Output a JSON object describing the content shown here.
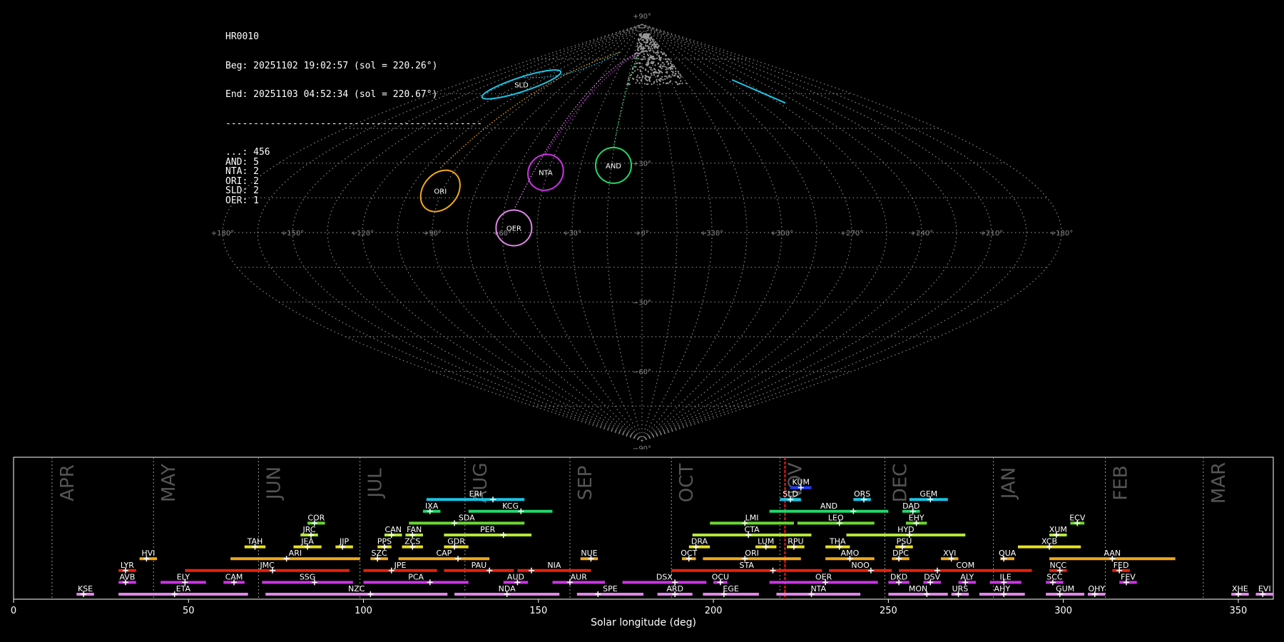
{
  "info": {
    "title": "HR0010",
    "beg": "Beg: 20251102 19:02:57 (sol = 220.26°)",
    "end": "End: 20251103 04:52:34 (sol = 220.67°)",
    "rule": "----------------------------------------------",
    "counts": [
      {
        "code": "...",
        "count": "456"
      },
      {
        "code": "AND",
        "count": "5"
      },
      {
        "code": "NTA",
        "count": "2"
      },
      {
        "code": "ORI",
        "count": "2"
      },
      {
        "code": "SLD",
        "count": "2"
      },
      {
        "code": "OER",
        "count": "1"
      }
    ]
  },
  "sky_map": {
    "lat_labels": [
      "+90°",
      "+30°",
      "−30°",
      "−60°",
      "−90°"
    ],
    "lon_labels": [
      "+180°",
      "+150°",
      "+120°",
      "+90°",
      "+60°",
      "+30°",
      "+0°",
      "+330°",
      "+300°",
      "+270°",
      "+240°",
      "+210°",
      "+180°"
    ],
    "radiants": [
      {
        "code": "SLD",
        "color": "#19c6e6",
        "lon": 118,
        "lat": 64
      },
      {
        "code": "ORI",
        "color": "#f0a818",
        "lon": 91,
        "lat": 18
      },
      {
        "code": "NTA",
        "color": "#cc33e6",
        "lon": 46,
        "lat": 26
      },
      {
        "code": "AND",
        "color": "#22d86a",
        "lon": 14,
        "lat": 29
      },
      {
        "code": "OER",
        "color": "#e085e8",
        "lon": 55,
        "lat": 2
      }
    ]
  },
  "chart_data": {
    "type": "timeline",
    "xlabel": "Solar longitude (deg)",
    "xlim": [
      0,
      360
    ],
    "xticks": [
      0,
      50,
      100,
      150,
      200,
      250,
      300,
      350
    ],
    "current_sol": 220.46,
    "months": [
      {
        "label": "APR",
        "start": 11
      },
      {
        "label": "MAY",
        "start": 40
      },
      {
        "label": "JUN",
        "start": 70
      },
      {
        "label": "JUL",
        "start": 99
      },
      {
        "label": "AUG",
        "start": 129
      },
      {
        "label": "SEP",
        "start": 159
      },
      {
        "label": "OCT",
        "start": 188
      },
      {
        "label": "NOV",
        "start": 219
      },
      {
        "label": "DEC",
        "start": 249
      },
      {
        "label": "JAN",
        "start": 280
      },
      {
        "label": "FEB",
        "start": 312
      },
      {
        "label": "MAR",
        "start": 340
      }
    ],
    "showers": [
      {
        "code": "KUM",
        "start": 222,
        "end": 228,
        "peak": 225,
        "row": 9,
        "color": "#1f3cff"
      },
      {
        "code": "ERI",
        "start": 118,
        "end": 146,
        "peak": 137,
        "row": 8,
        "color": "#19c6e6"
      },
      {
        "code": "SLD",
        "start": 219,
        "end": 225,
        "peak": 222,
        "row": 8,
        "color": "#19c6e6"
      },
      {
        "code": "ORS",
        "start": 240,
        "end": 245,
        "peak": 243,
        "row": 8,
        "color": "#19c6e6"
      },
      {
        "code": "GEM",
        "start": 256,
        "end": 267,
        "peak": 262,
        "row": 8,
        "color": "#19c6e6"
      },
      {
        "code": "IXA",
        "start": 117,
        "end": 122,
        "peak": 119,
        "row": 7,
        "color": "#22d86a"
      },
      {
        "code": "KCG",
        "start": 130,
        "end": 154,
        "peak": 145,
        "row": 7,
        "color": "#22d86a"
      },
      {
        "code": "AND",
        "start": 216,
        "end": 250,
        "peak": 240,
        "row": 7,
        "color": "#22d86a"
      },
      {
        "code": "DAD",
        "start": 254,
        "end": 259,
        "peak": 257,
        "row": 7,
        "color": "#22d86a"
      },
      {
        "code": "COR",
        "start": 84,
        "end": 89,
        "peak": 86,
        "row": 6,
        "color": "#6ad830"
      },
      {
        "code": "SDA",
        "start": 113,
        "end": 146,
        "peak": 126,
        "row": 6,
        "color": "#6ad830"
      },
      {
        "code": "LMI",
        "start": 199,
        "end": 223,
        "peak": 209,
        "row": 6,
        "color": "#6ad830"
      },
      {
        "code": "LEO",
        "start": 224,
        "end": 246,
        "peak": 236,
        "row": 6,
        "color": "#6ad830"
      },
      {
        "code": "EHY",
        "start": 255,
        "end": 261,
        "peak": 258,
        "row": 6,
        "color": "#6ad830"
      },
      {
        "code": "ECV",
        "start": 302,
        "end": 306,
        "peak": 304,
        "row": 6,
        "color": "#6ad830"
      },
      {
        "code": "JRC",
        "start": 82,
        "end": 87,
        "peak": 85,
        "row": 5,
        "color": "#b6e63a"
      },
      {
        "code": "CAN",
        "start": 106,
        "end": 111,
        "peak": 108,
        "row": 5,
        "color": "#b6e63a"
      },
      {
        "code": "FAN",
        "start": 112,
        "end": 117,
        "peak": 114,
        "row": 5,
        "color": "#b6e63a"
      },
      {
        "code": "PER",
        "start": 123,
        "end": 148,
        "peak": 140,
        "row": 5,
        "color": "#b6e63a"
      },
      {
        "code": "CTA",
        "start": 194,
        "end": 228,
        "peak": 210,
        "row": 5,
        "color": "#b6e63a"
      },
      {
        "code": "HYD",
        "start": 238,
        "end": 272,
        "peak": 256,
        "row": 5,
        "color": "#b6e63a"
      },
      {
        "code": "XUM",
        "start": 296,
        "end": 301,
        "peak": 298,
        "row": 5,
        "color": "#b6e63a"
      },
      {
        "code": "TAH",
        "start": 66,
        "end": 72,
        "peak": 69,
        "row": 4,
        "color": "#e8e020"
      },
      {
        "code": "JEA",
        "start": 80,
        "end": 88,
        "peak": 84,
        "row": 4,
        "color": "#e8e020"
      },
      {
        "code": "JIP",
        "start": 92,
        "end": 97,
        "peak": 94,
        "row": 4,
        "color": "#e8e020"
      },
      {
        "code": "PPS",
        "start": 104,
        "end": 108,
        "peak": 106,
        "row": 4,
        "color": "#e8e020"
      },
      {
        "code": "ZCS",
        "start": 111,
        "end": 117,
        "peak": 114,
        "row": 4,
        "color": "#e8e020"
      },
      {
        "code": "GDR",
        "start": 123,
        "end": 130,
        "peak": 126,
        "row": 4,
        "color": "#e8e020"
      },
      {
        "code": "DRA",
        "start": 193,
        "end": 199,
        "peak": 195,
        "row": 4,
        "color": "#e8e020"
      },
      {
        "code": "LUM",
        "start": 212,
        "end": 218,
        "peak": 215,
        "row": 4,
        "color": "#e8e020"
      },
      {
        "code": "RPU",
        "start": 221,
        "end": 226,
        "peak": 223,
        "row": 4,
        "color": "#e8e020"
      },
      {
        "code": "THA",
        "start": 232,
        "end": 239,
        "peak": 236,
        "row": 4,
        "color": "#e8e020"
      },
      {
        "code": "PSU",
        "start": 252,
        "end": 257,
        "peak": 254,
        "row": 4,
        "color": "#e8e020"
      },
      {
        "code": "XCB",
        "start": 287,
        "end": 305,
        "peak": 296,
        "row": 4,
        "color": "#e8e020"
      },
      {
        "code": "HVI",
        "start": 36,
        "end": 41,
        "peak": 38,
        "row": 3,
        "color": "#f0a818"
      },
      {
        "code": "ARI",
        "start": 62,
        "end": 99,
        "peak": 78,
        "row": 3,
        "color": "#f0a818"
      },
      {
        "code": "SZC",
        "start": 102,
        "end": 107,
        "peak": 104,
        "row": 3,
        "color": "#f0a818"
      },
      {
        "code": "CAP",
        "start": 110,
        "end": 136,
        "peak": 127,
        "row": 3,
        "color": "#f0a818"
      },
      {
        "code": "NUE",
        "start": 162,
        "end": 167,
        "peak": 165,
        "row": 3,
        "color": "#f0a818"
      },
      {
        "code": "OCT",
        "start": 191,
        "end": 195,
        "peak": 193,
        "row": 3,
        "color": "#f0a818"
      },
      {
        "code": "ORI",
        "start": 197,
        "end": 225,
        "peak": 209,
        "row": 3,
        "color": "#f0a818"
      },
      {
        "code": "AMO",
        "start": 232,
        "end": 246,
        "peak": 239,
        "row": 3,
        "color": "#f0a818"
      },
      {
        "code": "DPC",
        "start": 251,
        "end": 256,
        "peak": 253,
        "row": 3,
        "color": "#f0a818"
      },
      {
        "code": "XVI",
        "start": 265,
        "end": 270,
        "peak": 268,
        "row": 3,
        "color": "#f0a818"
      },
      {
        "code": "QUA",
        "start": 282,
        "end": 286,
        "peak": 283,
        "row": 3,
        "color": "#f0a818"
      },
      {
        "code": "AAN",
        "start": 296,
        "end": 332,
        "peak": 314,
        "row": 3,
        "color": "#f0a818"
      },
      {
        "code": "LYR",
        "start": 30,
        "end": 35,
        "peak": 32,
        "row": 2,
        "color": "#e8200c"
      },
      {
        "code": "JMC",
        "start": 49,
        "end": 96,
        "peak": 74,
        "row": 2,
        "color": "#e8200c"
      },
      {
        "code": "JPE",
        "start": 100,
        "end": 121,
        "peak": 108,
        "row": 2,
        "color": "#e8200c"
      },
      {
        "code": "PAU",
        "start": 123,
        "end": 143,
        "peak": 136,
        "row": 2,
        "color": "#e8200c"
      },
      {
        "code": "NIA",
        "start": 144,
        "end": 165,
        "peak": 148,
        "row": 2,
        "color": "#e8200c"
      },
      {
        "code": "STA",
        "start": 188,
        "end": 231,
        "peak": 217,
        "row": 2,
        "color": "#e8200c"
      },
      {
        "code": "NOO",
        "start": 233,
        "end": 251,
        "peak": 245,
        "row": 2,
        "color": "#e8200c"
      },
      {
        "code": "COM",
        "start": 253,
        "end": 291,
        "peak": 264,
        "row": 2,
        "color": "#e8200c"
      },
      {
        "code": "NCC",
        "start": 296,
        "end": 301,
        "peak": 299,
        "row": 2,
        "color": "#e8200c"
      },
      {
        "code": "FED",
        "start": 314,
        "end": 319,
        "peak": 316,
        "row": 2,
        "color": "#e8200c"
      },
      {
        "code": "AVB",
        "start": 30,
        "end": 35,
        "peak": 32,
        "row": 1,
        "color": "#cc33e6"
      },
      {
        "code": "ELY",
        "start": 42,
        "end": 55,
        "peak": 49,
        "row": 1,
        "color": "#cc33e6"
      },
      {
        "code": "CAM",
        "start": 60,
        "end": 66,
        "peak": 63,
        "row": 1,
        "color": "#cc33e6"
      },
      {
        "code": "SSG",
        "start": 71,
        "end": 97,
        "peak": 86,
        "row": 1,
        "color": "#cc33e6"
      },
      {
        "code": "PCA",
        "start": 100,
        "end": 130,
        "peak": 119,
        "row": 1,
        "color": "#cc33e6"
      },
      {
        "code": "AUD",
        "start": 140,
        "end": 147,
        "peak": 144,
        "row": 1,
        "color": "#cc33e6"
      },
      {
        "code": "AUR",
        "start": 154,
        "end": 169,
        "peak": 159,
        "row": 1,
        "color": "#cc33e6"
      },
      {
        "code": "DSX",
        "start": 174,
        "end": 198,
        "peak": 189,
        "row": 1,
        "color": "#cc33e6"
      },
      {
        "code": "OCU",
        "start": 200,
        "end": 204,
        "peak": 202,
        "row": 1,
        "color": "#cc33e6"
      },
      {
        "code": "OER",
        "start": 216,
        "end": 247,
        "peak": 232,
        "row": 1,
        "color": "#cc33e6"
      },
      {
        "code": "DKD",
        "start": 250,
        "end": 256,
        "peak": 253,
        "row": 1,
        "color": "#cc33e6"
      },
      {
        "code": "DSV",
        "start": 260,
        "end": 265,
        "peak": 262,
        "row": 1,
        "color": "#cc33e6"
      },
      {
        "code": "ALY",
        "start": 270,
        "end": 275,
        "peak": 272,
        "row": 1,
        "color": "#cc33e6"
      },
      {
        "code": "ILE",
        "start": 279,
        "end": 288,
        "peak": 283,
        "row": 1,
        "color": "#cc33e6"
      },
      {
        "code": "SCC",
        "start": 295,
        "end": 300,
        "peak": 297,
        "row": 1,
        "color": "#cc33e6"
      },
      {
        "code": "FEV",
        "start": 316,
        "end": 321,
        "peak": 318,
        "row": 1,
        "color": "#cc33e6"
      },
      {
        "code": "KSE",
        "start": 18,
        "end": 23,
        "peak": 20,
        "row": 0,
        "color": "#e085e8"
      },
      {
        "code": "ETA",
        "start": 30,
        "end": 67,
        "peak": 46,
        "row": 0,
        "color": "#e085e8"
      },
      {
        "code": "NZC",
        "start": 72,
        "end": 124,
        "peak": 102,
        "row": 0,
        "color": "#e085e8"
      },
      {
        "code": "NDA",
        "start": 126,
        "end": 156,
        "peak": 141,
        "row": 0,
        "color": "#e085e8"
      },
      {
        "code": "SPE",
        "start": 161,
        "end": 180,
        "peak": 167,
        "row": 0,
        "color": "#e085e8"
      },
      {
        "code": "ARD",
        "start": 184,
        "end": 194,
        "peak": 189,
        "row": 0,
        "color": "#e085e8"
      },
      {
        "code": "EGE",
        "start": 197,
        "end": 213,
        "peak": 203,
        "row": 0,
        "color": "#e085e8"
      },
      {
        "code": "NTA",
        "start": 218,
        "end": 242,
        "peak": 228,
        "row": 0,
        "color": "#e085e8"
      },
      {
        "code": "MON",
        "start": 250,
        "end": 267,
        "peak": 261,
        "row": 0,
        "color": "#e085e8"
      },
      {
        "code": "URS",
        "start": 268,
        "end": 273,
        "peak": 270,
        "row": 0,
        "color": "#e085e8"
      },
      {
        "code": "AHY",
        "start": 276,
        "end": 289,
        "peak": 283,
        "row": 0,
        "color": "#e085e8"
      },
      {
        "code": "GUM",
        "start": 295,
        "end": 306,
        "peak": 299,
        "row": 0,
        "color": "#e085e8"
      },
      {
        "code": "OHY",
        "start": 307,
        "end": 312,
        "peak": 309,
        "row": 0,
        "color": "#e085e8"
      },
      {
        "code": "XHE",
        "start": 348,
        "end": 353,
        "peak": 350,
        "row": 0,
        "color": "#e085e8"
      },
      {
        "code": "EVI",
        "start": 355,
        "end": 360,
        "peak": 357,
        "row": 0,
        "color": "#e085e8"
      }
    ]
  }
}
